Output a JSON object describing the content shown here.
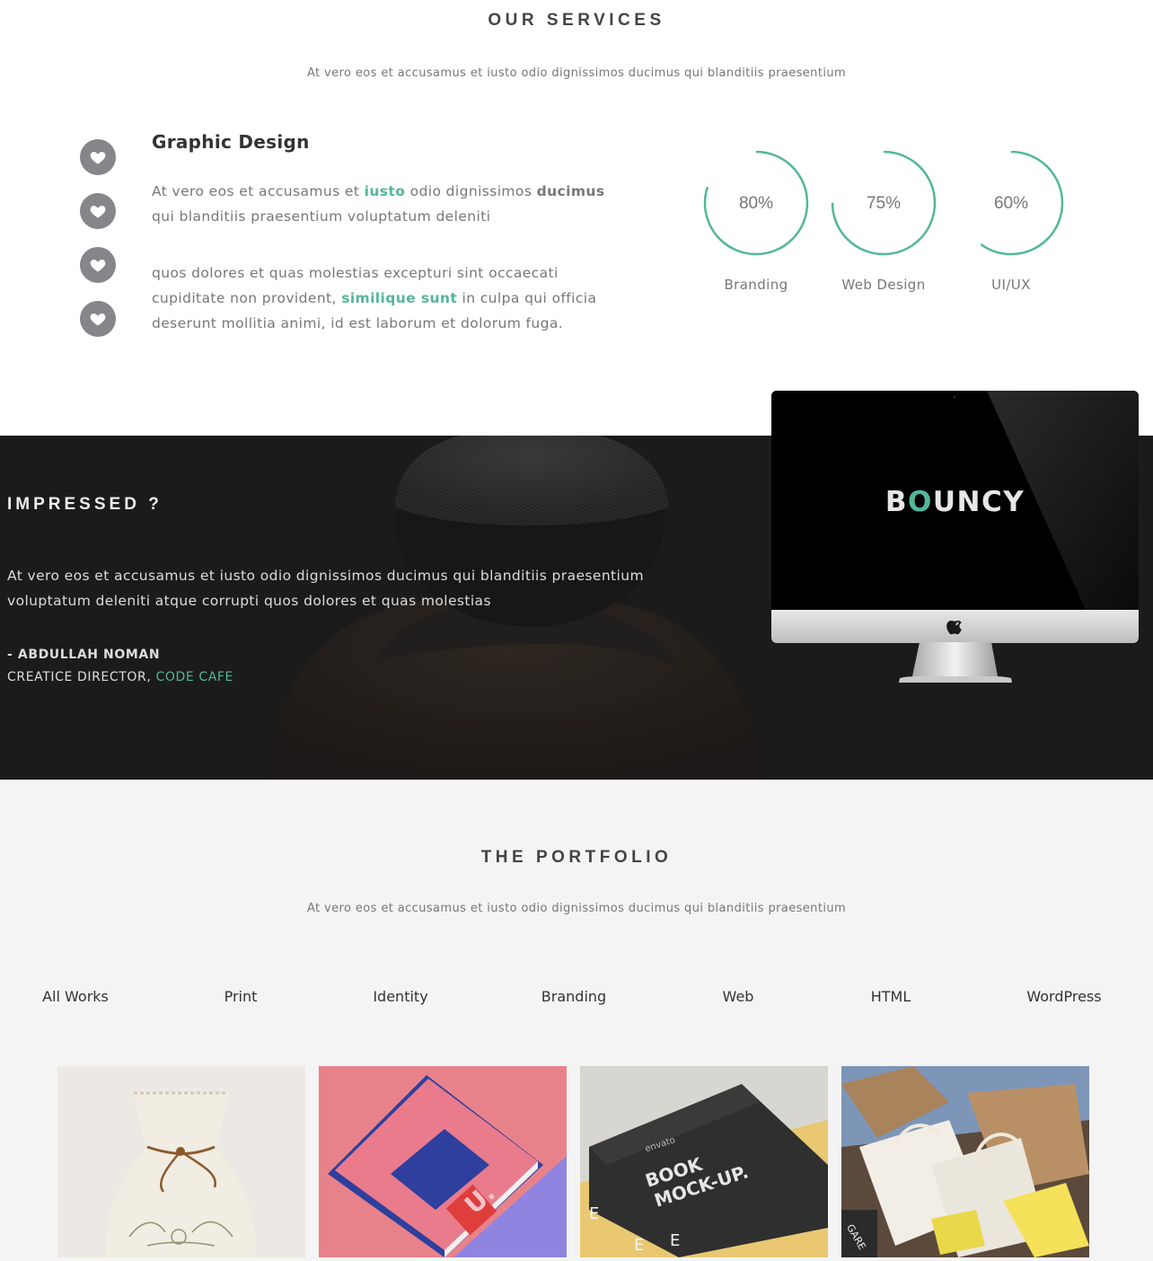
{
  "services": {
    "title": "OUR SERVICES",
    "subtitle": "At vero eos et accusamus et iusto odio dignissimos ducimus qui blanditiis praesentium",
    "icons": [
      "heart-icon",
      "heart-icon",
      "heart-icon",
      "heart-icon"
    ],
    "heading": "Graphic Design",
    "para1": {
      "a": "At vero eos et accusamus et ",
      "b": "iusto",
      "c": " odio dignissimos ",
      "d": "ducimus",
      "e": " qui blanditiis praesentium voluptatum deleniti"
    },
    "para2": {
      "a": "quos dolores et quas molestias excepturi sint occaecati cupiditate non provident, ",
      "b": "similique sunt",
      "c": " in culpa qui officia deserunt mollitia animi, id est laborum et dolorum fuga."
    },
    "skills": [
      {
        "label": "Branding",
        "value_text": "80%",
        "percent": 80
      },
      {
        "label": "Web Design",
        "value_text": "75%",
        "percent": 75
      },
      {
        "label": "UI/UX",
        "value_text": "60%",
        "percent": 60
      }
    ],
    "accent_color": "#52b79a"
  },
  "impressed": {
    "title": "IMPRESSED ?",
    "quote": "At vero eos et accusamus et iusto odio dignissimos ducimus qui blanditiis praesentium voluptatum deleniti atque corrupti quos dolores et quas molestias",
    "author": "- ABDULLAH NOMAN",
    "role": "CREATICE DIRECTOR, ",
    "company": "CODE CAFE",
    "device_logo": {
      "pre": "B",
      "o": "O",
      "post": "UNCY"
    }
  },
  "portfolio": {
    "title": "THE PORTFOLIO",
    "subtitle": "At vero eos et accusamus et iusto odio dignissimos ducimus qui blanditiis praesentium",
    "filters": [
      "All Works",
      "Print",
      "Identity",
      "Branding",
      "Web",
      "HTML",
      "WordPress"
    ]
  }
}
